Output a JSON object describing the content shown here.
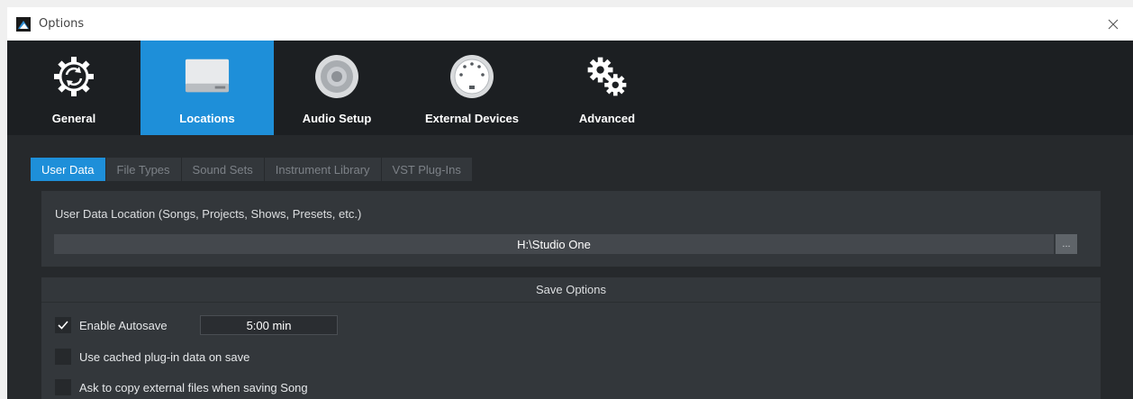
{
  "window": {
    "title": "Options",
    "close_glyph": "✕"
  },
  "categories": [
    {
      "label": "General",
      "icon": "gear-sync-icon",
      "active": false
    },
    {
      "label": "Locations",
      "icon": "drive-icon",
      "active": true
    },
    {
      "label": "Audio Setup",
      "icon": "speaker-icon",
      "active": false
    },
    {
      "label": "External Devices",
      "icon": "midi-port-icon",
      "active": false
    },
    {
      "label": "Advanced",
      "icon": "gears-icon",
      "active": false
    }
  ],
  "tabs": [
    {
      "label": "User Data",
      "active": true
    },
    {
      "label": "File Types",
      "active": false
    },
    {
      "label": "Sound Sets",
      "active": false
    },
    {
      "label": "Instrument Library",
      "active": false
    },
    {
      "label": "VST Plug-Ins",
      "active": false
    }
  ],
  "user_data": {
    "location_label": "User Data Location (Songs, Projects, Shows, Presets, etc.)",
    "path": "H:\\Studio One",
    "browse_label": "..."
  },
  "save_options": {
    "header": "Save Options",
    "autosave": {
      "label": "Enable Autosave",
      "checked": true,
      "interval": "5:00 min"
    },
    "cached_plugin": {
      "label": "Use cached plug-in data on save",
      "checked": false
    },
    "copy_external": {
      "label": "Ask to copy external files when saving Song",
      "checked": false
    }
  },
  "colors": {
    "accent": "#1e8fd9",
    "background": "#1f2225",
    "panel": "#33373b"
  }
}
